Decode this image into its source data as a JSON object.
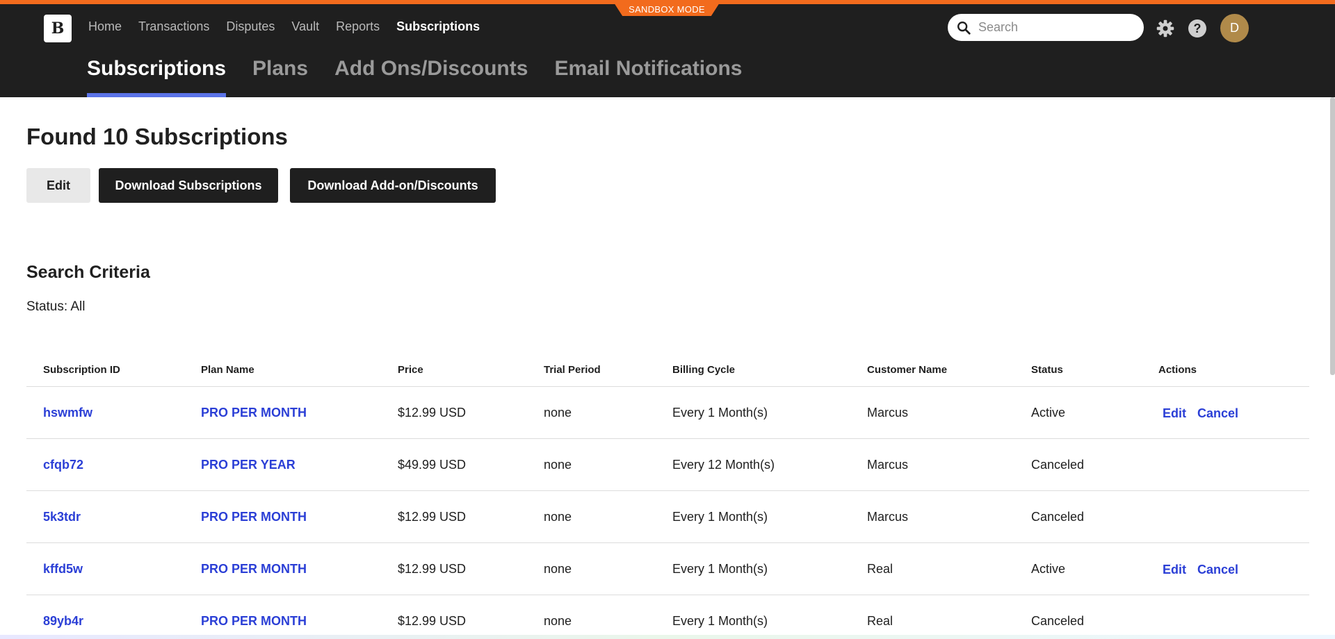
{
  "banner": {
    "sandbox_label": "SANDBOX MODE",
    "accent_color": "#f26b1d"
  },
  "header": {
    "logo_letter": "B",
    "nav": [
      {
        "label": "Home",
        "active": false
      },
      {
        "label": "Transactions",
        "active": false
      },
      {
        "label": "Disputes",
        "active": false
      },
      {
        "label": "Vault",
        "active": false
      },
      {
        "label": "Reports",
        "active": false
      },
      {
        "label": "Subscriptions",
        "active": true
      }
    ],
    "search_placeholder": "Search",
    "help_label": "?",
    "avatar_initial": "D"
  },
  "subnav": {
    "tabs": [
      {
        "label": "Subscriptions",
        "active": true
      },
      {
        "label": "Plans",
        "active": false
      },
      {
        "label": "Add Ons/Discounts",
        "active": false
      },
      {
        "label": "Email Notifications",
        "active": false
      }
    ],
    "active_underline_color": "#5b73e8"
  },
  "main": {
    "title": "Found 10 Subscriptions",
    "buttons": {
      "edit": "Edit",
      "download_subscriptions": "Download Subscriptions",
      "download_addons": "Download Add-on/Discounts"
    },
    "criteria_title": "Search Criteria",
    "criteria_status": "Status: All"
  },
  "table": {
    "columns": [
      "Subscription ID",
      "Plan Name",
      "Price",
      "Trial Period",
      "Billing Cycle",
      "Customer Name",
      "Status",
      "Actions"
    ],
    "rows": [
      {
        "id": "hswmfw",
        "plan": "PRO PER MONTH",
        "price": "$12.99 USD",
        "trial": "none",
        "cycle": "Every 1 Month(s)",
        "customer": "Marcus",
        "status": "Active",
        "actions": [
          "Edit",
          "Cancel"
        ]
      },
      {
        "id": "cfqb72",
        "plan": "PRO PER YEAR",
        "price": "$49.99 USD",
        "trial": "none",
        "cycle": "Every 12 Month(s)",
        "customer": "Marcus",
        "status": "Canceled",
        "actions": []
      },
      {
        "id": "5k3tdr",
        "plan": "PRO PER MONTH",
        "price": "$12.99 USD",
        "trial": "none",
        "cycle": "Every 1 Month(s)",
        "customer": "Marcus",
        "status": "Canceled",
        "actions": []
      },
      {
        "id": "kffd5w",
        "plan": "PRO PER MONTH",
        "price": "$12.99 USD",
        "trial": "none",
        "cycle": "Every 1 Month(s)",
        "customer": "Real",
        "status": "Active",
        "actions": [
          "Edit",
          "Cancel"
        ]
      },
      {
        "id": "89yb4r",
        "plan": "PRO PER MONTH",
        "price": "$12.99 USD",
        "trial": "none",
        "cycle": "Every 1 Month(s)",
        "customer": "Real",
        "status": "Canceled",
        "actions": []
      }
    ],
    "link_color": "#2b3fd6"
  },
  "icons": {
    "search": "search-icon",
    "settings": "gear-icon",
    "help": "help-icon"
  }
}
